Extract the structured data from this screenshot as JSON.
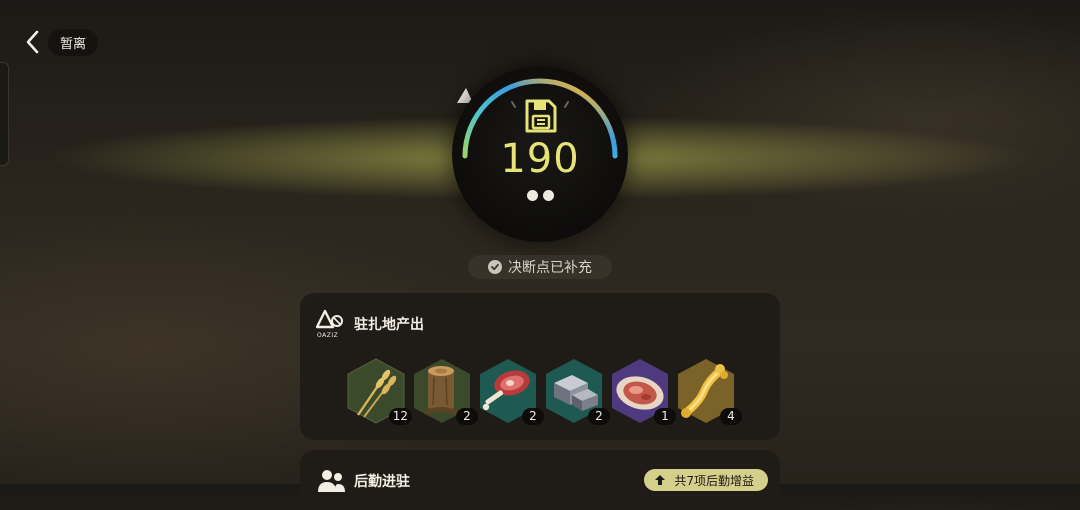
{
  "header": {
    "back_label": "暂离"
  },
  "dial": {
    "value": "190",
    "dots_count": 2,
    "accent_color": "#e6e377"
  },
  "status": {
    "text": "决断点已补充"
  },
  "output_panel": {
    "title": "驻扎地产出",
    "logo_text": "OAZIZ",
    "items": [
      {
        "icon": "wheat-icon",
        "count": "12",
        "bg": "#3b4a2a"
      },
      {
        "icon": "wood-stump-icon",
        "count": "2",
        "bg": "#3b4a2a"
      },
      {
        "icon": "meat-steak-icon",
        "count": "2",
        "bg": "#1f5a52"
      },
      {
        "icon": "metal-ore-icon",
        "count": "2",
        "bg": "#1f5a52"
      },
      {
        "icon": "raw-meat-plate-icon",
        "count": "1",
        "bg": "#4f3a80"
      },
      {
        "icon": "golden-bone-icon",
        "count": "4",
        "bg": "#7a6228"
      }
    ]
  },
  "logistics_panel": {
    "title": "后勤进驻",
    "upgrade_label": "共7项后勤增益"
  }
}
